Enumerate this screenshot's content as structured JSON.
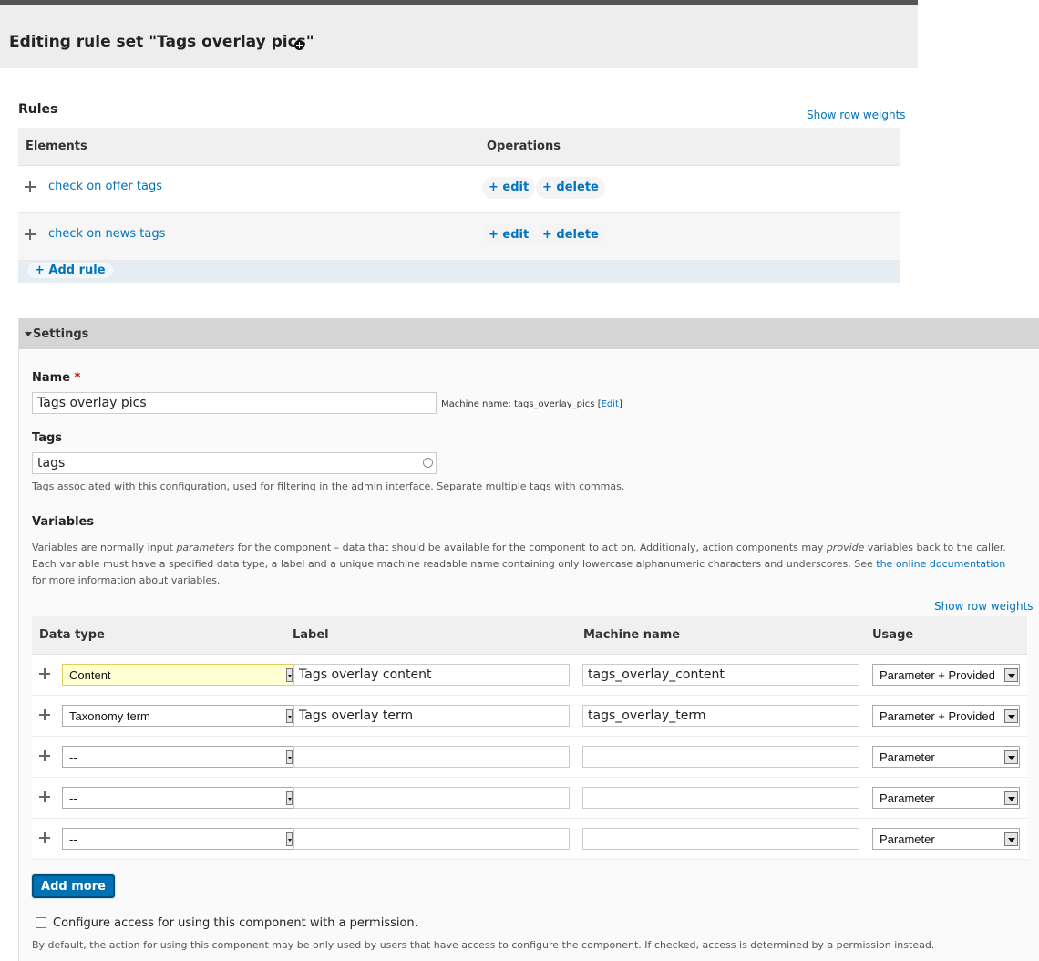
{
  "page": {
    "title": "Editing rule set \"Tags overlay pics\""
  },
  "rules": {
    "caption": "Rules",
    "show_row_weights": "Show row weights",
    "col_elements": "Elements",
    "col_operations": "Operations",
    "items": [
      {
        "label": "check on offer tags",
        "edit": "+ edit",
        "delete": "+ delete"
      },
      {
        "label": "check on news tags",
        "edit": "+ edit",
        "delete": "+ delete"
      }
    ],
    "add_rule": "+ Add rule"
  },
  "settings": {
    "legend": "Settings",
    "name_label": "Name",
    "required_mark": "*",
    "name_value": "Tags overlay pics",
    "machine_name_text": "Machine name: tags_overlay_pics [",
    "machine_name_edit": "Edit",
    "machine_name_close": "]",
    "tags_label": "Tags",
    "tags_value": "tags",
    "tags_description": "Tags associated with this configuration, used for filtering in the admin interface. Separate multiple tags with commas.",
    "variables_label": "Variables",
    "variables_desc_1": "Variables are normally input ",
    "variables_desc_parameters": "parameters",
    "variables_desc_2": " for the component – data that should be available for the component to act on. Additionaly, action components may ",
    "variables_desc_provide": "provide",
    "variables_desc_3": " variables back to the caller. Each variable must have a specified data type, a label and a unique machine readable name containing only lowercase alphanumeric characters and underscores. See ",
    "variables_desc_link": "the online documentation",
    "variables_desc_4": " for more information about variables.",
    "show_row_weights": "Show row weights",
    "col_data_type": "Data type",
    "col_label": "Label",
    "col_machine_name": "Machine name",
    "col_usage": "Usage",
    "variables": [
      {
        "data_type": "Content",
        "label": "Tags overlay content",
        "machine_name": "tags_overlay_content",
        "usage": "Parameter + Provided"
      },
      {
        "data_type": "Taxonomy term",
        "label": "Tags overlay term",
        "machine_name": "tags_overlay_term",
        "usage": "Parameter + Provided"
      },
      {
        "data_type": "--",
        "label": "",
        "machine_name": "",
        "usage": "Parameter"
      },
      {
        "data_type": "--",
        "label": "",
        "machine_name": "",
        "usage": "Parameter"
      },
      {
        "data_type": "--",
        "label": "",
        "machine_name": "",
        "usage": "Parameter"
      }
    ],
    "add_more": "Add more",
    "access_checkbox_label": "Configure access for using this component with a permission.",
    "access_description": "By default, the action for using this component may be only used by users that have access to configure the component. If checked, access is determined by a permission instead."
  }
}
